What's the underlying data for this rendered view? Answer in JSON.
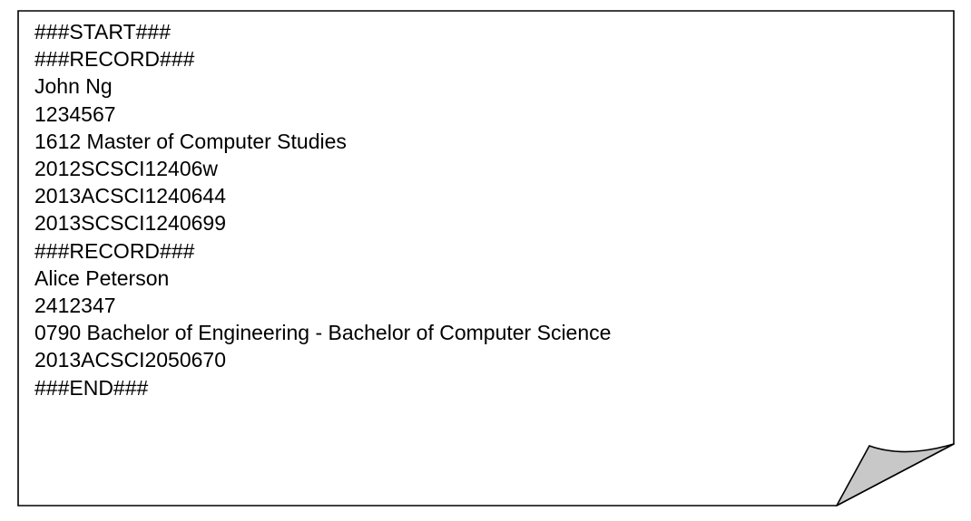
{
  "document": {
    "lines": [
      "###START###",
      "###RECORD###",
      "John Ng",
      "1234567",
      "1612 Master of Computer Studies",
      "2012SCSCI12406w",
      "2013ACSCI1240644",
      "2013SCSCI1240699",
      "###RECORD###",
      "Alice Peterson",
      "2412347",
      "0790 Bachelor of Engineering - Bachelor of Computer Science",
      "2013ACSCI2050670",
      "###END###"
    ]
  },
  "colors": {
    "page_border": "#000000",
    "curl_fill": "#c8c8c8",
    "text": "#000000"
  }
}
